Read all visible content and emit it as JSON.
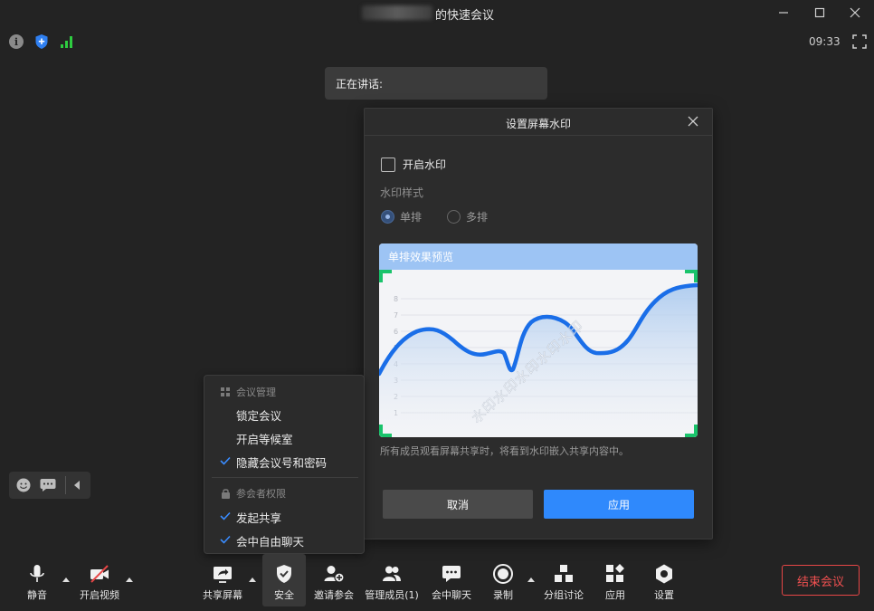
{
  "window": {
    "title": "的快速会议",
    "clock": "09:33"
  },
  "speaking_banner": "正在讲话:",
  "watermark_dialog": {
    "title": "设置屏幕水印",
    "enable_label": "开启水印",
    "enable_checked": false,
    "style_label": "水印样式",
    "options": [
      {
        "label": "单排",
        "checked": true
      },
      {
        "label": "多排",
        "checked": false
      }
    ],
    "preview_title": "单排效果预览",
    "watermark_text": "水印水印水印水印水印",
    "axis_ticks": [
      "8",
      "7",
      "6",
      "5",
      "4",
      "3",
      "2",
      "1"
    ],
    "description": "所有成员观看屏幕共享时，将看到水印嵌入共享内容中。",
    "cancel_label": "取消",
    "apply_label": "应用"
  },
  "security_menu": {
    "section1": "会议管理",
    "section1_items": [
      {
        "label": "锁定会议",
        "checked": false
      },
      {
        "label": "开启等候室",
        "checked": false
      },
      {
        "label": "隐藏会议号和密码",
        "checked": true
      }
    ],
    "section2": "参会者权限",
    "section2_items": [
      {
        "label": "发起共享",
        "checked": true
      },
      {
        "label": "会中自由聊天",
        "checked": true
      }
    ]
  },
  "toolbar": {
    "mute": "静音",
    "video": "开启视频",
    "share": "共享屏幕",
    "security": "安全",
    "invite": "邀请参会",
    "members": "管理成员(1)",
    "chat": "会中聊天",
    "record": "录制",
    "breakout": "分组讨论",
    "apps": "应用",
    "settings": "设置",
    "end": "结束会议"
  },
  "colors": {
    "accent": "#2f89fc",
    "end": "#f05050",
    "check": "#3a8cff",
    "signal": "#2ecc40",
    "preview_corner": "#19c36b"
  }
}
